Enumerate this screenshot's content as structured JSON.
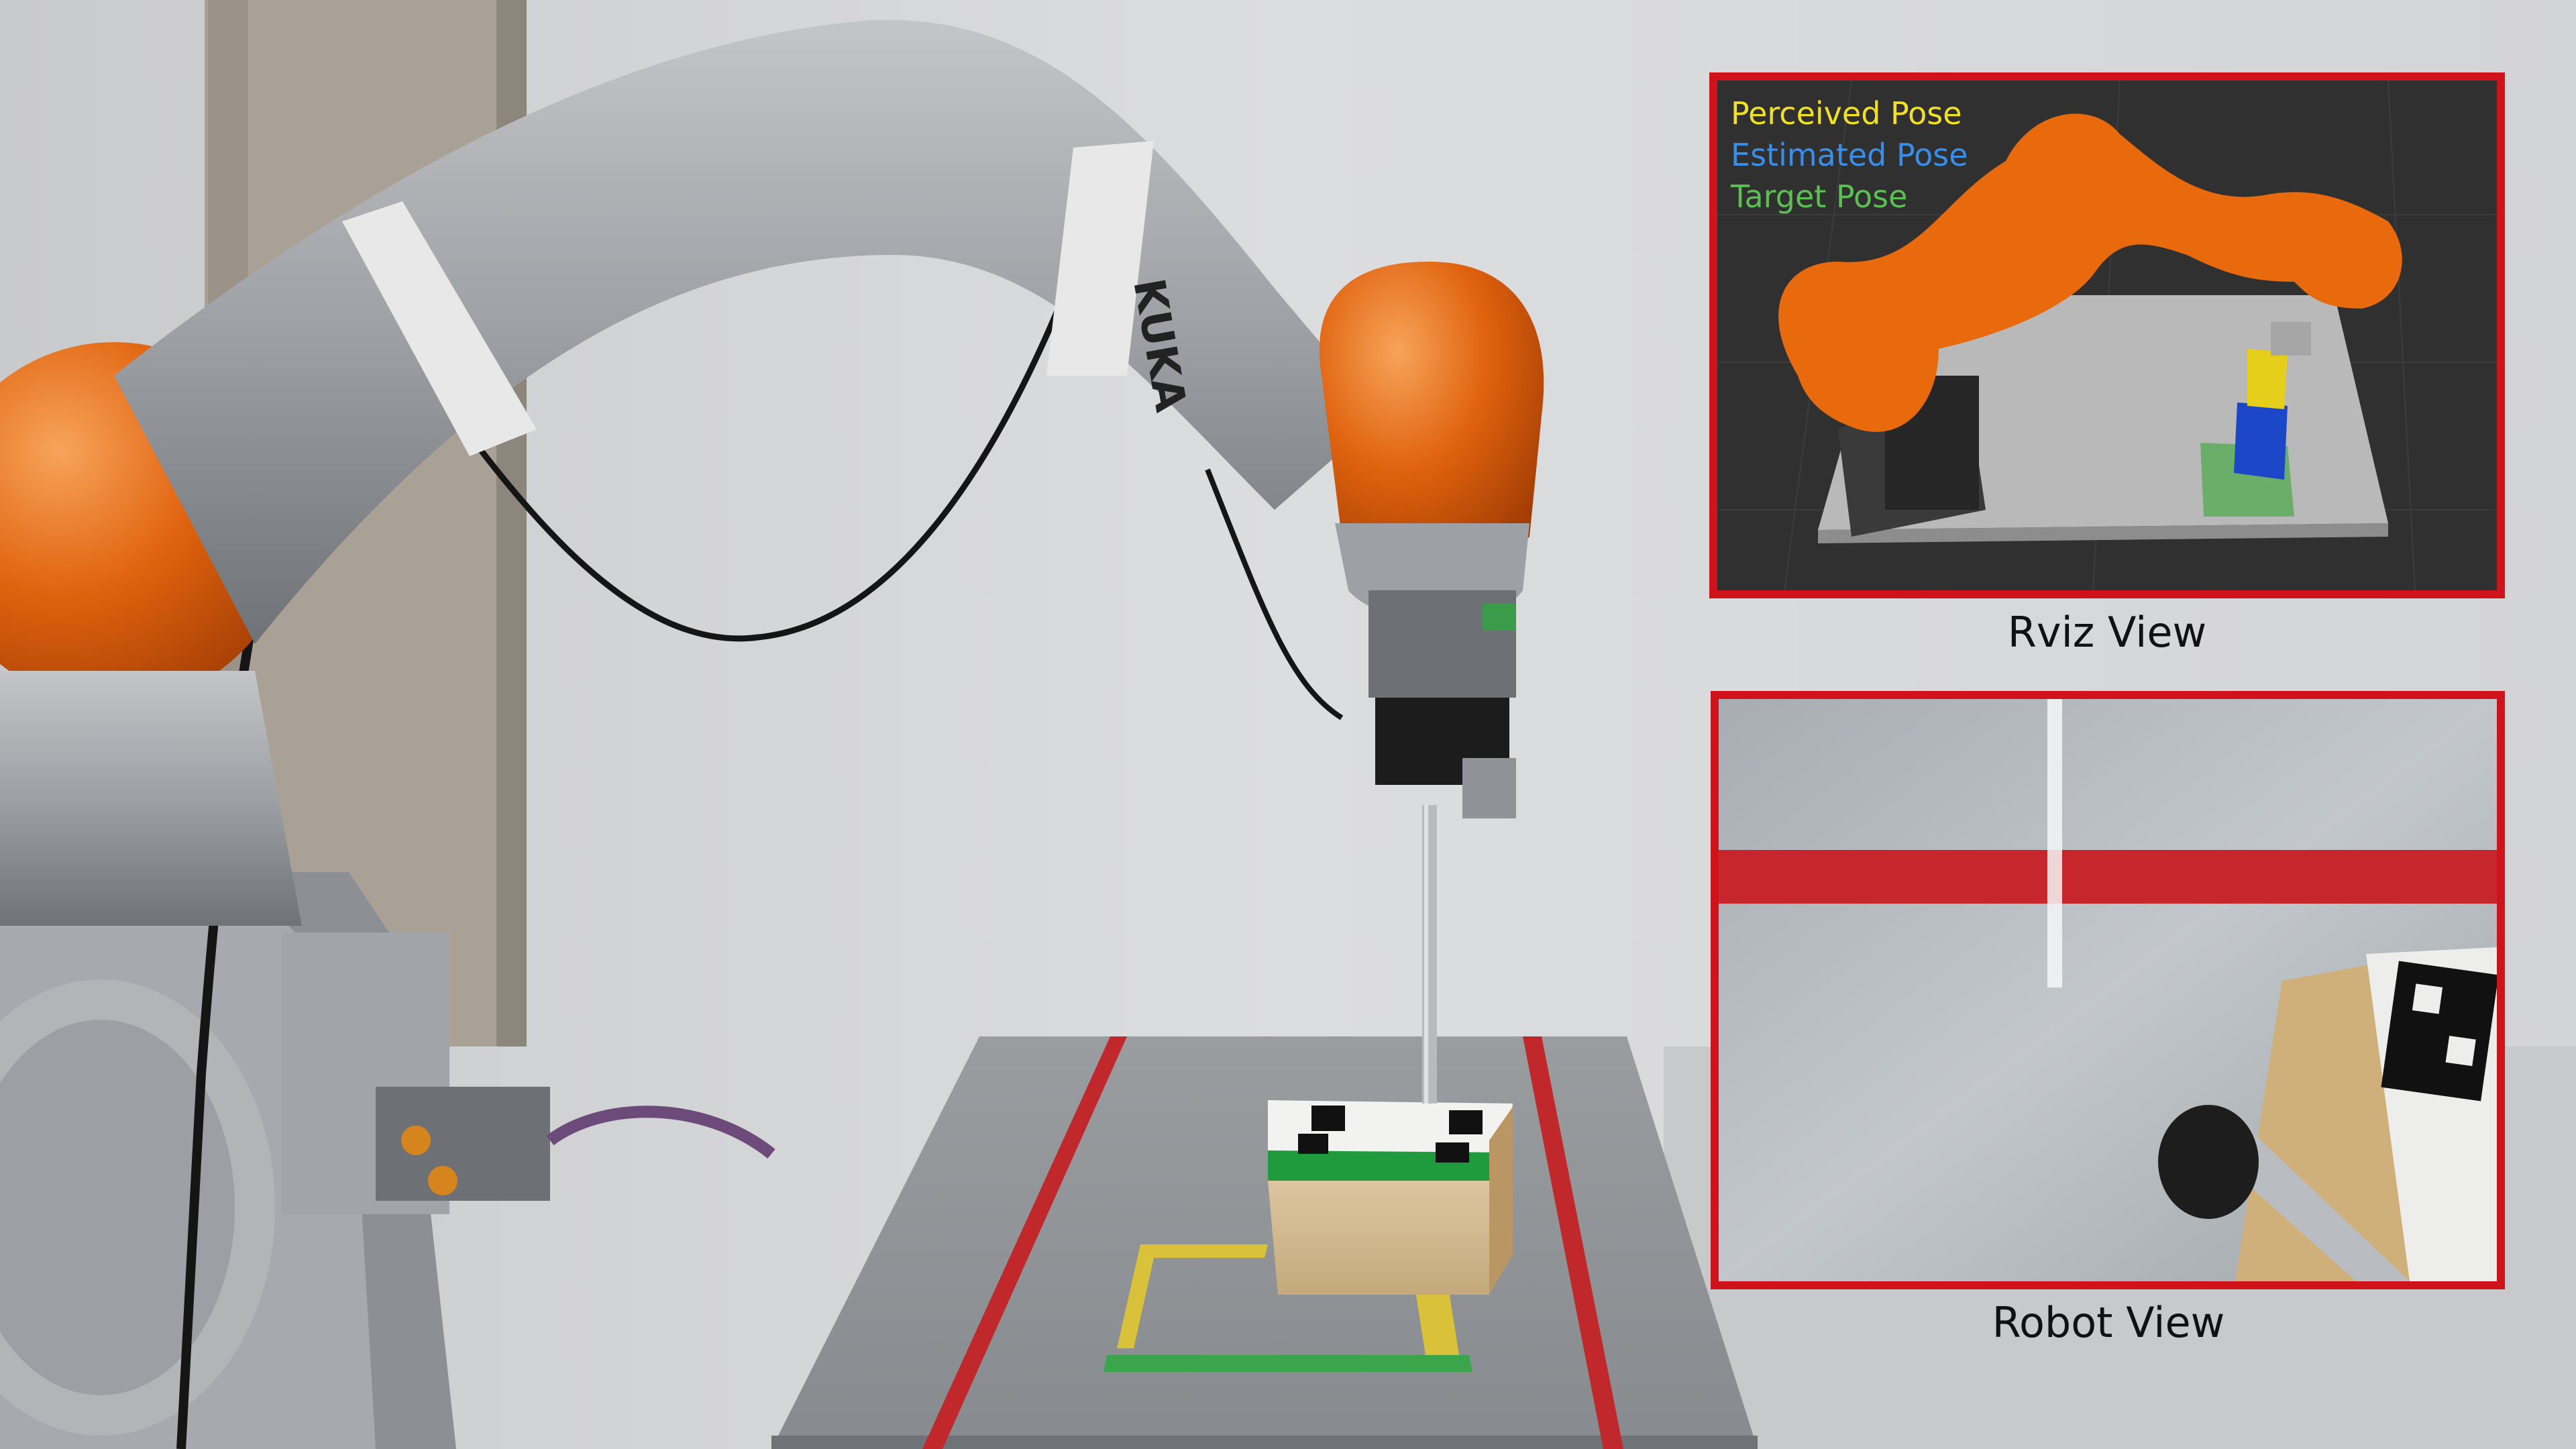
{
  "rviz": {
    "legend": {
      "perceived": "Perceived Pose",
      "estimated": "Estimated Pose",
      "target": "Target Pose"
    },
    "caption": "Rviz View"
  },
  "robot_view": {
    "caption": "Robot View"
  },
  "robot_arm": {
    "brand_label": "KUKA"
  },
  "colors": {
    "frame": "#d0131b",
    "perceived": "#f2e022",
    "estimated": "#3a8ee8",
    "target": "#5cbf54",
    "arm_orange": "#e0620e",
    "arm_gray": "#9a9c9f"
  }
}
